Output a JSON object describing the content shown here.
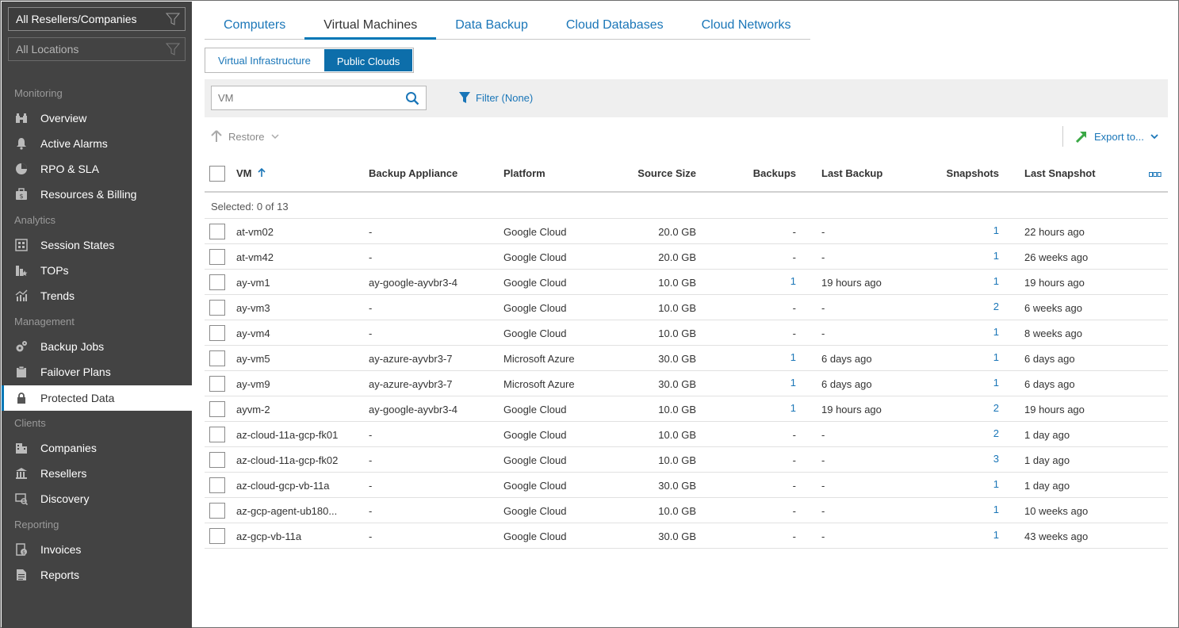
{
  "sidebar": {
    "scope_company": "All Resellers/Companies",
    "scope_location": "All Locations",
    "sections": {
      "monitoring": "Monitoring",
      "analytics": "Analytics",
      "management": "Management",
      "clients": "Clients",
      "reporting": "Reporting"
    },
    "items": {
      "overview": "Overview",
      "active_alarms": "Active Alarms",
      "rpo_sla": "RPO & SLA",
      "resources_billing": "Resources & Billing",
      "session_states": "Session States",
      "tops": "TOPs",
      "trends": "Trends",
      "backup_jobs": "Backup Jobs",
      "failover_plans": "Failover Plans",
      "protected_data": "Protected Data",
      "companies": "Companies",
      "resellers": "Resellers",
      "discovery": "Discovery",
      "invoices": "Invoices",
      "reports": "Reports"
    }
  },
  "tabs": [
    "Computers",
    "Virtual Machines",
    "Data Backup",
    "Cloud Databases",
    "Cloud Networks"
  ],
  "active_tab": "Virtual Machines",
  "subtabs": [
    "Virtual Infrastructure",
    "Public Clouds"
  ],
  "active_subtab": "Public Clouds",
  "search": {
    "placeholder": "VM"
  },
  "filter_label": "Filter (None)",
  "restore_label": "Restore",
  "export_label": "Export to...",
  "columns": {
    "vm": "VM",
    "appliance": "Backup Appliance",
    "platform": "Platform",
    "size": "Source Size",
    "backups": "Backups",
    "last_backup": "Last Backup",
    "snapshots": "Snapshots",
    "last_snapshot": "Last Snapshot"
  },
  "selection_info": "Selected: 0 of 13",
  "rows": [
    {
      "vm": "at-vm02",
      "appliance": "-",
      "platform": "Google Cloud",
      "size": "20.0 GB",
      "backups": "-",
      "last_backup": "-",
      "snapshots": "1",
      "last_snapshot": "22 hours ago"
    },
    {
      "vm": "at-vm42",
      "appliance": "-",
      "platform": "Google Cloud",
      "size": "20.0 GB",
      "backups": "-",
      "last_backup": "-",
      "snapshots": "1",
      "last_snapshot": "26 weeks ago"
    },
    {
      "vm": "ay-vm1",
      "appliance": "ay-google-ayvbr3-4",
      "platform": "Google Cloud",
      "size": "10.0 GB",
      "backups": "1",
      "last_backup": "19 hours ago",
      "snapshots": "1",
      "last_snapshot": "19 hours ago"
    },
    {
      "vm": "ay-vm3",
      "appliance": "-",
      "platform": "Google Cloud",
      "size": "10.0 GB",
      "backups": "-",
      "last_backup": "-",
      "snapshots": "2",
      "last_snapshot": "6 weeks ago"
    },
    {
      "vm": "ay-vm4",
      "appliance": "-",
      "platform": "Google Cloud",
      "size": "10.0 GB",
      "backups": "-",
      "last_backup": "-",
      "snapshots": "1",
      "last_snapshot": "8 weeks ago"
    },
    {
      "vm": "ay-vm5",
      "appliance": "ay-azure-ayvbr3-7",
      "platform": "Microsoft Azure",
      "size": "30.0 GB",
      "backups": "1",
      "last_backup": "6 days ago",
      "snapshots": "1",
      "last_snapshot": "6 days ago"
    },
    {
      "vm": "ay-vm9",
      "appliance": "ay-azure-ayvbr3-7",
      "platform": "Microsoft Azure",
      "size": "30.0 GB",
      "backups": "1",
      "last_backup": "6 days ago",
      "snapshots": "1",
      "last_snapshot": "6 days ago"
    },
    {
      "vm": "ayvm-2",
      "appliance": "ay-google-ayvbr3-4",
      "platform": "Google Cloud",
      "size": "10.0 GB",
      "backups": "1",
      "last_backup": "19 hours ago",
      "snapshots": "2",
      "last_snapshot": "19 hours ago"
    },
    {
      "vm": "az-cloud-11a-gcp-fk01",
      "appliance": "-",
      "platform": "Google Cloud",
      "size": "10.0 GB",
      "backups": "-",
      "last_backup": "-",
      "snapshots": "2",
      "last_snapshot": "1 day ago"
    },
    {
      "vm": "az-cloud-11a-gcp-fk02",
      "appliance": "-",
      "platform": "Google Cloud",
      "size": "10.0 GB",
      "backups": "-",
      "last_backup": "-",
      "snapshots": "3",
      "last_snapshot": "1 day ago"
    },
    {
      "vm": "az-cloud-gcp-vb-11a",
      "appliance": "-",
      "platform": "Google Cloud",
      "size": "30.0 GB",
      "backups": "-",
      "last_backup": "-",
      "snapshots": "1",
      "last_snapshot": "1 day ago"
    },
    {
      "vm": "az-gcp-agent-ub180...",
      "appliance": "-",
      "platform": "Google Cloud",
      "size": "10.0 GB",
      "backups": "-",
      "last_backup": "-",
      "snapshots": "1",
      "last_snapshot": "10 weeks ago"
    },
    {
      "vm": "az-gcp-vb-11a",
      "appliance": "-",
      "platform": "Google Cloud",
      "size": "30.0 GB",
      "backups": "-",
      "last_backup": "-",
      "snapshots": "1",
      "last_snapshot": "43 weeks ago"
    }
  ],
  "colors": {
    "accent": "#0077b6",
    "link": "#1a76b8",
    "sidebar_bg": "#434343",
    "export_arrow": "#3aa845"
  }
}
